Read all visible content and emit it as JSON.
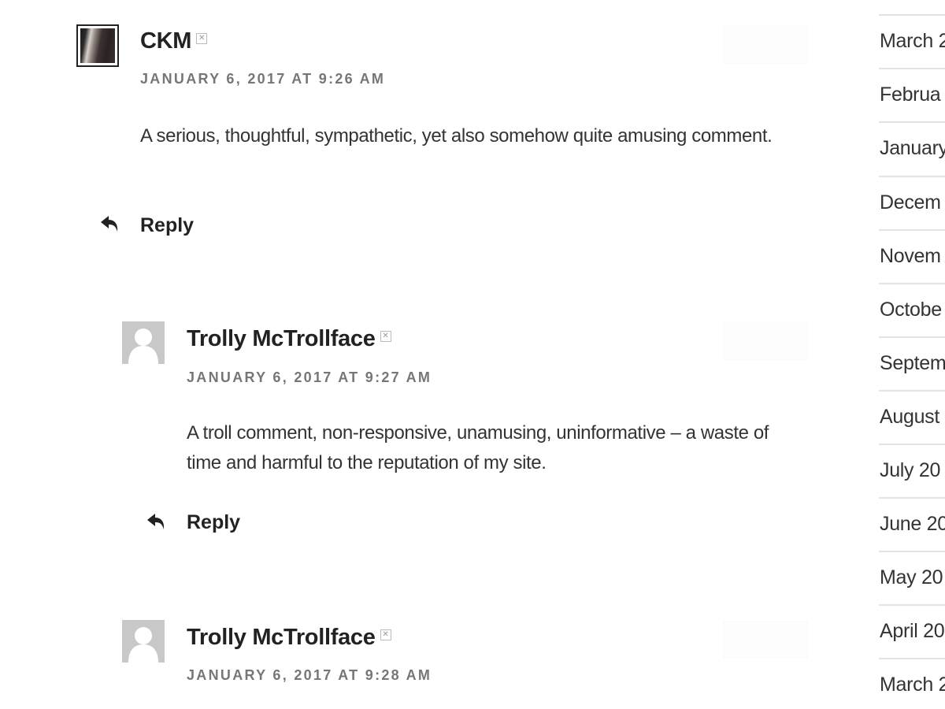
{
  "comments": [
    {
      "author": "CKM",
      "date": "January 6, 2017 at 9:26 AM",
      "text": "A serious, thoughtful, sympathetic, yet also somehow quite amusing comment.",
      "avatar": "photo-avatar",
      "reply_label": "Reply",
      "reply_icon": "reply-arrow-icon",
      "author_badge_icon": "broken-image-icon"
    },
    {
      "author": "Trolly McTrollface",
      "date": "January 6, 2017 at 9:27 AM",
      "text": "A troll comment, non-responsive, unamusing, uninformative – a waste of time and harmful to the reputation of my site.",
      "avatar": "default-avatar",
      "reply_label": "Reply",
      "reply_icon": "reply-arrow-icon",
      "author_badge_icon": "broken-image-icon"
    },
    {
      "author": "Trolly McTrollface",
      "date": "January 6, 2017 at 9:28 AM",
      "avatar": "default-avatar",
      "author_badge_icon": "broken-image-icon"
    }
  ],
  "sidebar": {
    "archives": [
      "March 2",
      "Februa",
      "January",
      "Decem",
      "Novem",
      "Octobe",
      "Septem",
      "August",
      "July 20",
      "June 20",
      "May 20",
      "April 20",
      "March 2"
    ]
  },
  "colors": {
    "text": "#333333",
    "heading": "#222222",
    "meta": "#767676",
    "divider": "#e3e3e3",
    "avatar_default": "#c8c8c8"
  }
}
